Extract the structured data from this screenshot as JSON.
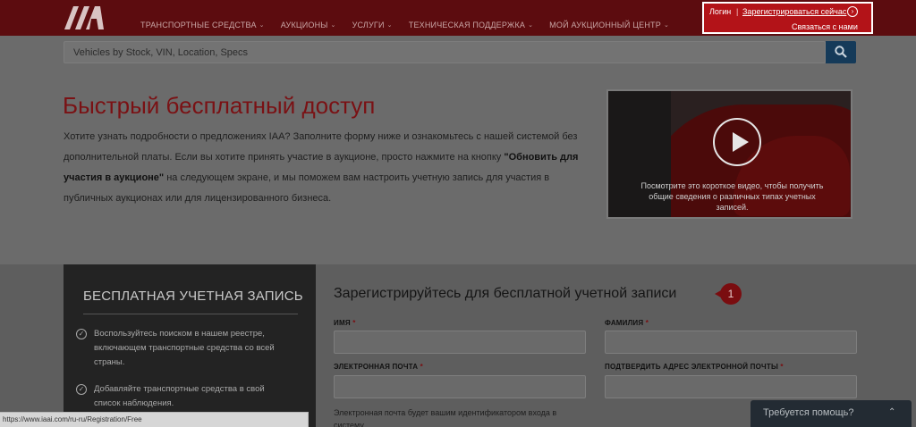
{
  "brand": {
    "logo_text": "IAA"
  },
  "nav": [
    {
      "label": "ТРАНСПОРТНЫЕ СРЕДСТВА"
    },
    {
      "label": "АУКЦИОНЫ"
    },
    {
      "label": "УСЛУГИ"
    },
    {
      "label": "ТЕХНИЧЕСКАЯ ПОДДЕРЖКА"
    },
    {
      "label": "МОЙ АУКЦИОННЫЙ ЦЕНТР"
    }
  ],
  "user": {
    "login": "Логин",
    "separator": "|",
    "register": "Зарегистрироваться сейчас",
    "contact": "Связаться с нами"
  },
  "search": {
    "placeholder": "Vehicles by Stock, VIN, Location, Specs"
  },
  "hero": {
    "title": "Быстрый бесплатный доступ",
    "text_1": "Хотите узнать подробности о предложениях IAA? Заполните форму ниже и ознакомьтесь с нашей системой без дополнительной платы. Если вы хотите принять участие в аукционе, просто нажмите на кнопку ",
    "text_bold": "\"Обновить для участия в аукционе\"",
    "text_2": " на следующем экране, и мы поможем вам настроить учетную запись для участия в публичных аукционах или для лицензированного бизнеса."
  },
  "video": {
    "caption": "Посмотрите это короткое видео, чтобы получить общие сведения о различных типах учетных записей."
  },
  "benefits": {
    "title": "БЕСПЛАТНАЯ УЧЕТНАЯ ЗАПИСЬ",
    "items": [
      {
        "text": "Воспользуйтесь поиском в нашем реестре, включающем транспортные средства со всей страны."
      },
      {
        "text": "Добавляйте транспортные средства в свой список наблюдения."
      }
    ]
  },
  "form": {
    "title": "Зарегистрируйтесь для бесплатной учетной записи",
    "step": "1",
    "required_mark": "*",
    "first_name_label": "ИМЯ",
    "last_name_label": "ФАМИЛИЯ",
    "email_label": "ЭЛЕКТРОННАЯ ПОЧТА",
    "confirm_email_label": "ПОДТВЕРДИТЬ АДРЕС ЭЛЕКТРОННОЙ ПОЧТЫ",
    "email_help": "Электронная почта будет вашим идентификатором входа в систему."
  },
  "status_url": "https://www.iaai.com/ru-ru/Registration/Free",
  "help_widget": {
    "label": "Требуется помощь?"
  }
}
